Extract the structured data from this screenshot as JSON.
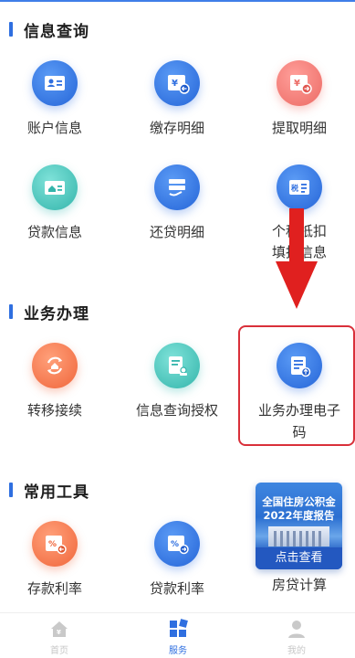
{
  "sections": {
    "info_query": {
      "title": "信息查询",
      "items": [
        {
          "label": "账户信息",
          "icon": "id-card-icon"
        },
        {
          "label": "缴存明细",
          "icon": "yuan-deposit-icon"
        },
        {
          "label": "提取明细",
          "icon": "yuan-withdraw-icon"
        },
        {
          "label": "贷款信息",
          "icon": "house-card-icon"
        },
        {
          "label": "还贷明细",
          "icon": "repay-stack-icon"
        },
        {
          "label": "个税抵扣填报信息",
          "icon": "tax-card-icon"
        }
      ]
    },
    "business": {
      "title": "业务办理",
      "items": [
        {
          "label": "转移接续",
          "icon": "transfer-house-icon"
        },
        {
          "label": "信息查询授权",
          "icon": "authorize-doc-icon"
        },
        {
          "label": "业务办理电子码",
          "icon": "e-code-doc-icon"
        }
      ]
    },
    "tools": {
      "title": "常用工具",
      "items": [
        {
          "label": "存款利率",
          "icon": "deposit-rate-icon"
        },
        {
          "label": "贷款利率",
          "icon": "loan-rate-icon"
        },
        {
          "label": "房贷计算",
          "icon": "banner-report"
        }
      ]
    }
  },
  "banner": {
    "line1": "全国住房公积金",
    "line2": "2022年度报告",
    "button": "点击查看"
  },
  "tabbar": {
    "home": "首页",
    "service": "服务",
    "mine": "我的"
  },
  "colors": {
    "accent": "#2f6fe0",
    "highlight": "#d9303a"
  }
}
